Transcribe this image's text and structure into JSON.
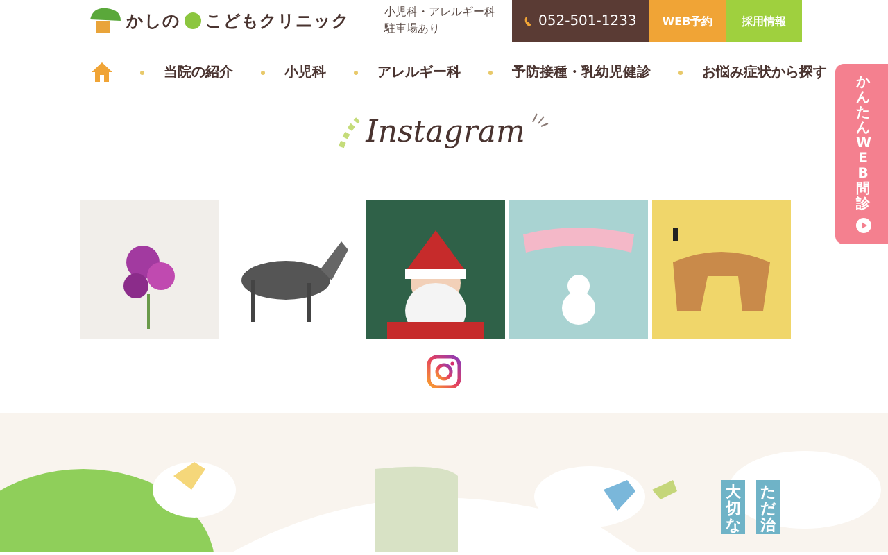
{
  "header": {
    "logo": "かしの",
    "logo_2": "こどもクリニック",
    "subtitle_lines": [
      "小児科・アレルギー科",
      "駐車場あり"
    ],
    "phone": "052-501-1233",
    "buttons": [
      {
        "label": "WEB予約",
        "color": "#f0a436"
      },
      {
        "label": "採用情報",
        "color": "#9fd03e"
      }
    ]
  },
  "nav": [
    {
      "label": "当院の紹介"
    },
    {
      "label": "小児科"
    },
    {
      "label": "アレルギー科"
    },
    {
      "label": "予防接種・乳幼児健診"
    },
    {
      "label": "お悩み症状から探す"
    }
  ],
  "side_tab": {
    "label": "かんたんWEB問診"
  },
  "instagram": {
    "title": "Instagram"
  },
  "hero": {
    "kind": "picture",
    "vertical_texts": [
      "大切な",
      "ただ治"
    ]
  }
}
